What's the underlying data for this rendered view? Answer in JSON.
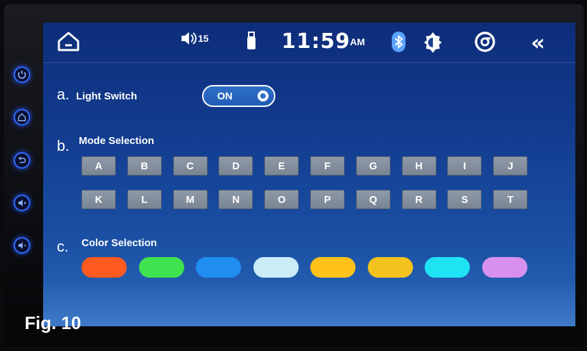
{
  "status_bar": {
    "volume_level": "15",
    "time": "11:59",
    "ampm": "AM",
    "back_label": "«"
  },
  "sections": {
    "light": {
      "letter": "a.",
      "title": "Light Switch",
      "toggle_label": "ON",
      "toggle_state": "on"
    },
    "mode": {
      "letter": "b.",
      "title": "Mode Selection",
      "buttons": [
        "A",
        "B",
        "C",
        "D",
        "E",
        "F",
        "G",
        "H",
        "I",
        "J",
        "K",
        "L",
        "M",
        "N",
        "O",
        "P",
        "Q",
        "R",
        "S",
        "T"
      ]
    },
    "color": {
      "letter": "c.",
      "title": "Color Selection",
      "colors": [
        "#ff5a1f",
        "#3fe24f",
        "#1f8ef0",
        "#c9ecf6",
        "#ffc21a",
        "#f3c21c",
        "#1fe3f3",
        "#d890ee"
      ]
    }
  },
  "side_buttons": [
    "power-icon",
    "home-icon",
    "back-icon",
    "volume-up-icon",
    "volume-down-icon"
  ],
  "caption": "Fig. 10"
}
